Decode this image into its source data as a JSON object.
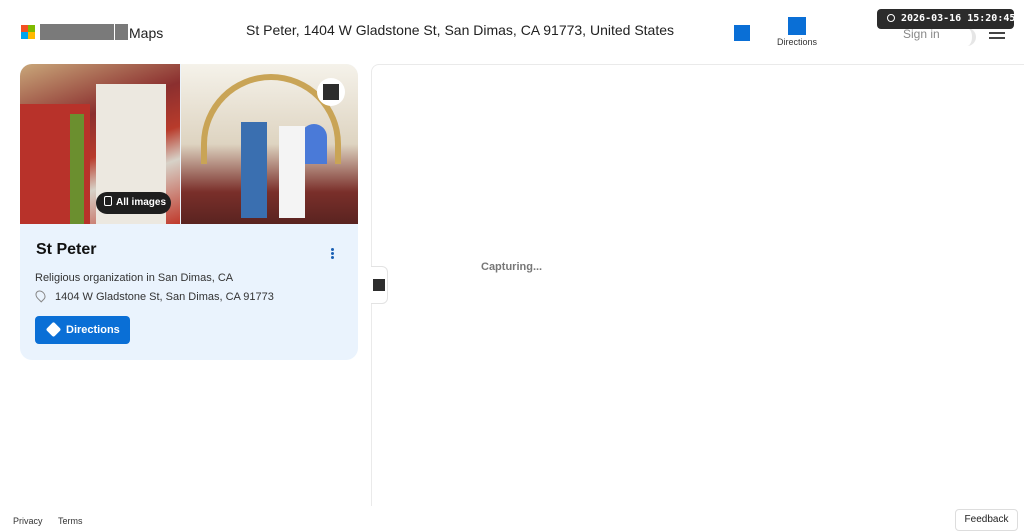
{
  "header": {
    "brand_suffix": "Maps",
    "title": "St Peter, 1404 W Gladstone St, San Dimas, CA 91773, United States",
    "directions_label": "Directions",
    "sign_in_label": "Sign in",
    "timestamp": "2026-03-16 15:20:45",
    "logo_colors": [
      "#f25022",
      "#7fba00",
      "#00a4ef",
      "#ffb900"
    ],
    "accent": "#0a6fd6"
  },
  "place": {
    "name": "St Peter",
    "category": "Religious organization in San Dimas, CA",
    "address": "1404 W Gladstone St, San Dimas, CA 91773",
    "directions_button": "Directions",
    "all_images_label": "All images"
  },
  "map": {
    "status": "Capturing..."
  },
  "footer": {
    "privacy": "Privacy",
    "terms": "Terms",
    "feedback": "Feedback"
  },
  "icons": [
    "clock-icon",
    "menu-icon",
    "image-icon",
    "more-options-icon",
    "location-pin-icon",
    "directions-icon",
    "collapse-icon"
  ]
}
